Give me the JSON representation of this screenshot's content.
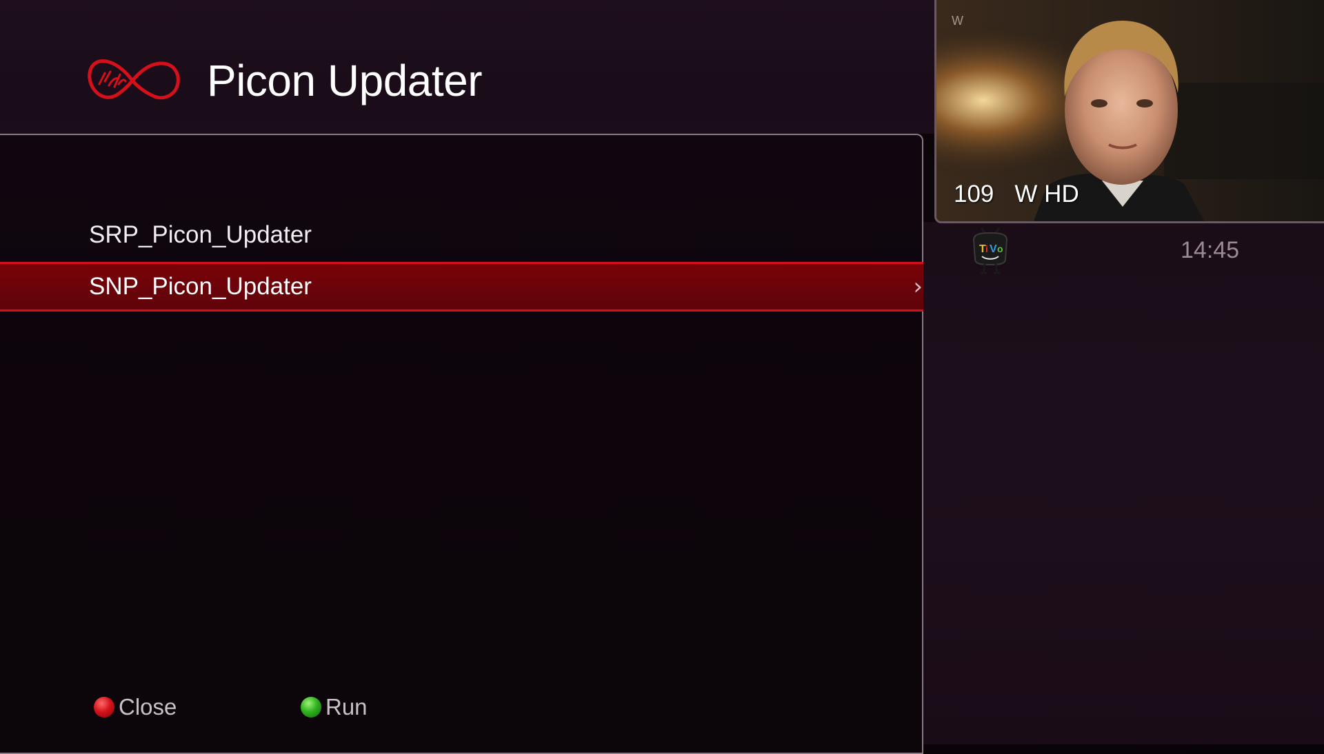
{
  "header": {
    "title": "Picon Updater",
    "logo_icon": "virgin-media-logo-icon"
  },
  "menu": {
    "items": [
      {
        "label": "SRP_Picon_Updater",
        "selected": false
      },
      {
        "label": "SNP_Picon_Updater",
        "selected": true
      }
    ],
    "selected_chevron": "›"
  },
  "footer": {
    "buttons": [
      {
        "label": "Close",
        "color": "#d4141c",
        "icon": "red-button-icon"
      },
      {
        "label": "Run",
        "color": "#2fb21e",
        "icon": "green-button-icon"
      }
    ]
  },
  "preview": {
    "channel_number": "109",
    "channel_name": "W HD"
  },
  "status": {
    "time": "14:45",
    "tivo_icon": "tivo-mascot-icon"
  },
  "colors": {
    "accent_red": "#d4101a",
    "selected_bg": "#6a040a",
    "background": "#0c050a",
    "clock": "#9a8a98"
  }
}
